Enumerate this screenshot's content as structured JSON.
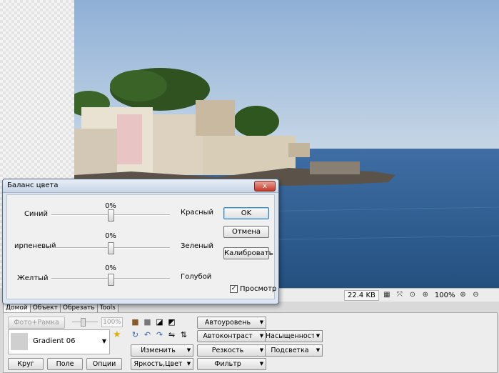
{
  "dialog": {
    "title": "Баланс цвета",
    "close_glyph": "x",
    "rows": [
      {
        "left": "Синий",
        "percent": "0%",
        "right": "Красный",
        "value": 0
      },
      {
        "left": "ирпеневый",
        "percent": "0%",
        "right": "Зеленый",
        "value": 0
      },
      {
        "left": "Желтый",
        "percent": "0%",
        "right": "Голубой",
        "value": 0
      }
    ],
    "ok_label": "OK",
    "cancel_label": "Отмена",
    "calibrate_label": "Калибровать",
    "preview_label": "Просмотр",
    "preview_checked": true
  },
  "statusbar": {
    "file_size": "22.4 KB",
    "zoom": "100%"
  },
  "tabs": [
    "Домой",
    "Объект",
    "Обрезать",
    "Tools"
  ],
  "toolbar": {
    "photo_frame_label": "Фото+Рамка",
    "opacity_value": "100%",
    "gradient_label": "Gradient 06",
    "circle_label": "Круг",
    "field_label": "Поле",
    "options_label": "Опции",
    "autolevel_label": "Автоуровень",
    "autocontrast_label": "Автоконтраст",
    "saturation_label": "Насыщенность",
    "change_label": "Изменить",
    "sharpness_label": "Резкость",
    "highlight_label": "Подсветка",
    "brightness_label": "Яркость,Цвет",
    "filter_label": "Фильтр"
  },
  "colors": {
    "sky": "#9fbbd9",
    "sea": "#2d5a8e",
    "dialog_bg": "#dde6f0"
  }
}
